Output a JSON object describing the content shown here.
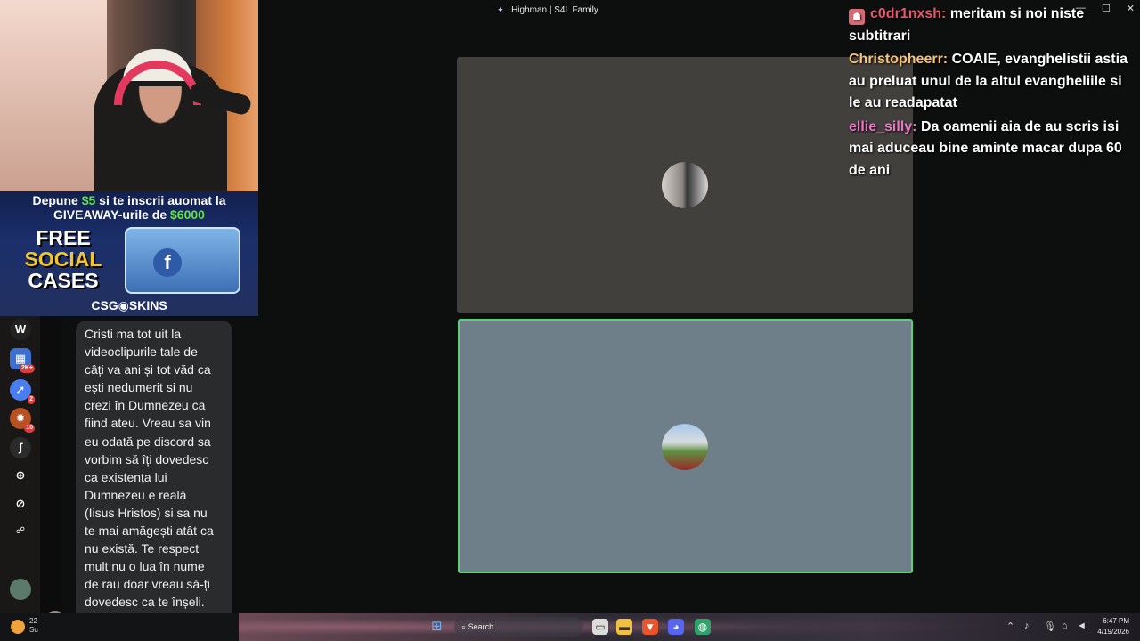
{
  "window": {
    "title": "Highman | S4L Family"
  },
  "ad": {
    "line1_prefix": "Depune ",
    "line1_amount": "$5",
    "line1_suffix": " si te inscrii auomat la",
    "line2_prefix": "GIVEAWAY-urile de ",
    "line2_amount": "$6000",
    "free1": "FREE",
    "free2": "SOCIAL",
    "free3": "CASES",
    "brand": "CSG◉SKINS"
  },
  "left_strip": {
    "badges": [
      "2K+",
      "2",
      "10"
    ]
  },
  "dm_message": {
    "text": "Cristi ma tot uit la\nvideoclipurile tale de\ncâți va ani și tot văd ca\nești nedumerit si nu\ncrezi în Dumnezeu ca\nfiind ateu. Vreau sa vin\neu odată pe discord sa\nvorbim să îți dovedesc\nca existența lui\nDumnezeu e reală\n(Iisus Hristos) si sa nu\nte mai amăgești atât ca\nnu există. Te respect\nmult nu o lua în nume\nde rau doar vreau să-ți\ndovedesc ca te înșeli.\nLove you"
  },
  "stream_chat": [
    {
      "user": "c0dr1nxsh:",
      "message": "meritam si noi niste subtitrari"
    },
    {
      "user": "Christopheerr:",
      "message": "COAIE, evanghelistii astia au preluat unul de la altul evangheliile si le au readapatat"
    },
    {
      "user": "ellie_silly:",
      "message": "Da oamenii aia de au scris isi mai aduceau bine aminte macar dupa 60 de ani"
    }
  ],
  "taskbar": {
    "weather_temp": "22",
    "weather_desc": "Su",
    "search_placeholder": "Search",
    "time": "6:47 PM",
    "date": "4/19/2026"
  },
  "colors": {
    "speaking_border": "#5ad277",
    "tile1_bg": "#42403d",
    "tile2_bg": "#6f7f89"
  }
}
